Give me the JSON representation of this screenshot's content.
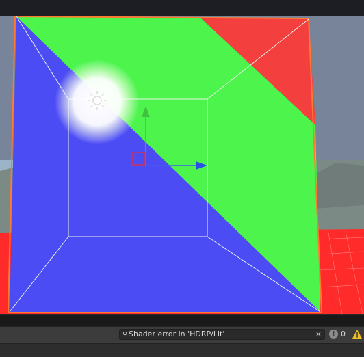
{
  "scene": {
    "colors": {
      "blue_face": "#4c4cf4",
      "green_face": "#4cf44c",
      "red_face": "#f43f3f",
      "selection_outline": "#ff7a2f",
      "wireframe": "#e8f4e8",
      "ground_red": "#ff2a2a",
      "gizmo_x": "#3f5ff0",
      "gizmo_y": "#3fc23f",
      "gizmo_z": "#d0305a"
    },
    "icons": {
      "light_gizmo": "sun-icon",
      "move_tool": "move-gizmo-icon"
    }
  },
  "toolbar": {
    "menu_icon": "hamburger-icon"
  },
  "console": {
    "search_text": "Shader error in 'HDRP/Lit'",
    "search_icon": "magnifier-icon",
    "clear_icon": "×",
    "info_count": "0",
    "info_icon_label": "!",
    "warning_icon": "warning-icon"
  }
}
